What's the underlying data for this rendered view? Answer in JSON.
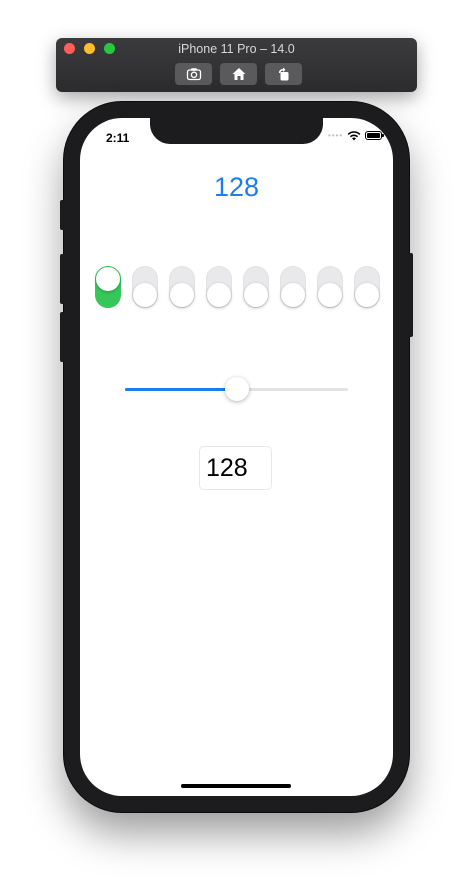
{
  "simulator": {
    "title": "iPhone 11 Pro – 14.0",
    "buttons": [
      "screenshot-icon",
      "home-icon",
      "rotate-icon"
    ]
  },
  "status_bar": {
    "time": "2:11"
  },
  "app": {
    "value_label": "128",
    "bits": [
      true,
      false,
      false,
      false,
      false,
      false,
      false,
      false
    ],
    "slider": {
      "value": 128,
      "min": 0,
      "max": 255
    },
    "number_field": {
      "value": "128"
    }
  },
  "colors": {
    "accent": "#1a7df0",
    "toggle_on": "#35c759",
    "toggle_off": "#e9e9eb"
  }
}
